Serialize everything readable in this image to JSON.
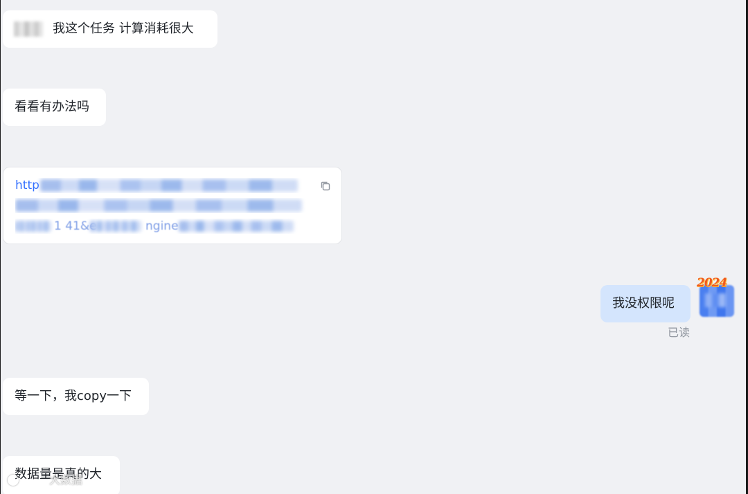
{
  "messages": [
    {
      "mention": "(blurred name)",
      "text": "我这个任务 计算消耗很大"
    },
    {
      "text": "看看有办法吗"
    },
    {
      "link_prefix": "http",
      "link_tail": "1 41&e",
      "link_tail_2": "ngine"
    },
    {
      "text": "我没权限呢",
      "status": "已读"
    },
    {
      "text": "等一下，我copy一下"
    },
    {
      "text": "数据量是真的大"
    }
  ],
  "avatar": {
    "badge": "2024"
  },
  "watermark": {
    "text": "大数据"
  },
  "icons": {
    "copy": "copy-icon",
    "avatar": "avatar"
  },
  "colors": {
    "background": "#f0f1f4",
    "bubble": "#ffffff",
    "my_bubble": "#d4e5fd",
    "link": "#3370ff",
    "muted_text": "#8f959e"
  }
}
